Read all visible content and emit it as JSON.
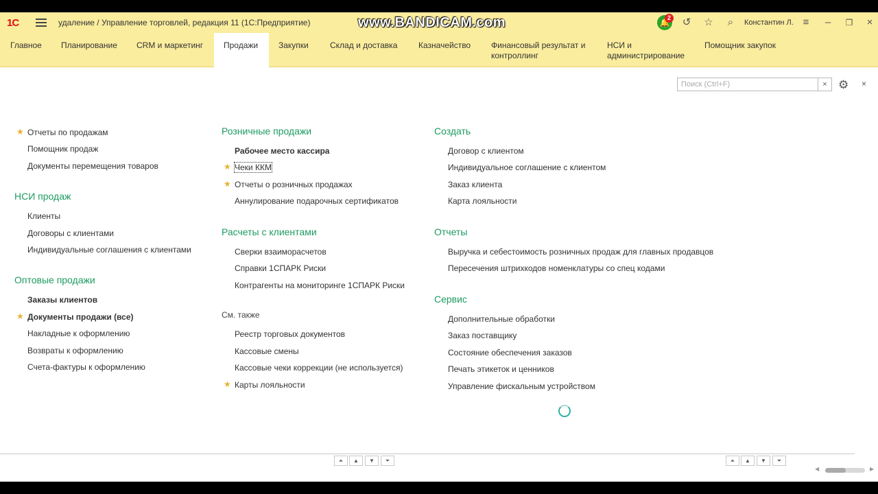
{
  "titlebar": {
    "logo": "1С",
    "title": "удаление / Управление торговлей, редакция 11  (1С:Предприятие)",
    "watermark": "www.BANDICAM.com",
    "notification_count": "2",
    "user": "Константин Л.",
    "icons": [
      "menu-icon",
      "bell-icon",
      "history-icon",
      "star-icon",
      "search-icon",
      "settings-lines-icon",
      "minimize-icon",
      "restore-icon",
      "close-icon"
    ]
  },
  "nav": {
    "items": [
      {
        "label": "Главное"
      },
      {
        "label": "Планирование"
      },
      {
        "label": "CRM и маркетинг"
      },
      {
        "label": "Продажи",
        "active": true
      },
      {
        "label": "Закупки"
      },
      {
        "label": "Склад и доставка"
      },
      {
        "label": "Казначейство"
      },
      {
        "label": "Финансовый результат и контроллинг"
      },
      {
        "label": "НСИ и администрирование"
      },
      {
        "label": "Помощник закупок"
      }
    ]
  },
  "search": {
    "placeholder": "Поиск (Ctrl+F)",
    "clear": "×",
    "close": "×"
  },
  "col1": {
    "top": [
      {
        "label": "Отчеты по продажам",
        "starred": true
      },
      {
        "label": "Помощник продаж"
      },
      {
        "label": "Документы перемещения товаров"
      }
    ],
    "nsi_title": "НСИ продаж",
    "nsi": [
      {
        "label": "Клиенты"
      },
      {
        "label": "Договоры с клиентами"
      },
      {
        "label": "Индивидуальные соглашения с клиентами"
      }
    ],
    "wholesale_title": "Оптовые продажи",
    "wholesale": [
      {
        "label": "Заказы клиентов",
        "bold": true
      },
      {
        "label": "Документы продажи (все)",
        "bold": true,
        "starred": true
      },
      {
        "label": "Накладные к оформлению"
      },
      {
        "label": "Возвраты к оформлению"
      },
      {
        "label": "Счета-фактуры к оформлению"
      }
    ]
  },
  "col2": {
    "retail_title": "Розничные продажи",
    "retail": [
      {
        "label": "Рабочее место кассира",
        "bold": true
      },
      {
        "label": "Чеки ККМ",
        "starred": true
      },
      {
        "label": "Отчеты о розничных продажах",
        "starred": true
      },
      {
        "label": "Аннулирование подарочных сертификатов"
      }
    ],
    "settlements_title": "Расчеты с клиентами",
    "settlements": [
      {
        "label": "Сверки взаиморасчетов"
      },
      {
        "label": "Справки 1СПАРК Риски"
      },
      {
        "label": "Контрагенты на мониторинге 1СПАРК Риски"
      }
    ],
    "see_also_title": "См. также",
    "see_also": [
      {
        "label": "Реестр торговых документов"
      },
      {
        "label": "Кассовые смены"
      },
      {
        "label": "Кассовые чеки коррекции (не используется)"
      },
      {
        "label": "Карты лояльности",
        "starred": true
      }
    ]
  },
  "col3": {
    "create_title": "Создать",
    "create": [
      {
        "label": "Договор с клиентом"
      },
      {
        "label": "Индивидуальное соглашение с клиентом"
      },
      {
        "label": "Заказ клиента"
      },
      {
        "label": "Карта лояльности"
      }
    ],
    "reports_title": "Отчеты",
    "reports": [
      {
        "label": "Выручка и себестоимость розничных продаж для главных продавцов"
      },
      {
        "label": "Пересечения штрихкодов номенклатуры со спец кодами"
      }
    ],
    "service_title": "Сервис",
    "service": [
      {
        "label": "Дополнительные обработки"
      },
      {
        "label": "Заказ поставщику"
      },
      {
        "label": "Состояние обеспечения заказов"
      },
      {
        "label": "Печать этикеток и ценников"
      },
      {
        "label": "Управление фискальным устройством"
      }
    ]
  },
  "colors": {
    "accent_green": "#1d9b60",
    "panel_yellow": "#fbed9e",
    "star": "#e9b12d"
  }
}
